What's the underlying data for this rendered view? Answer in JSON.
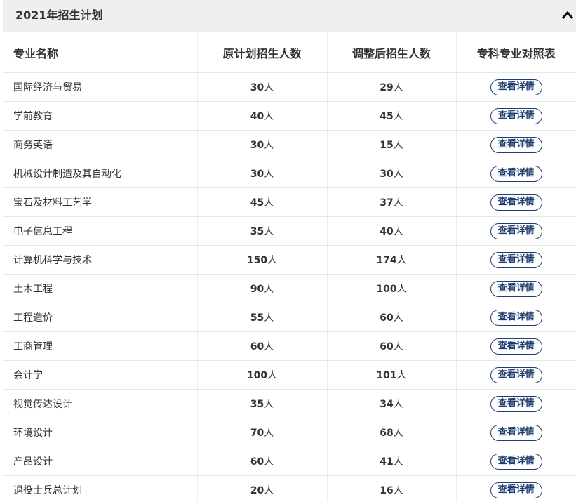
{
  "panel": {
    "title": "2021年招生计划",
    "collapse_icon": "chevron-up-icon"
  },
  "table": {
    "headers": {
      "major": "专业名称",
      "original": "原计划招生人数",
      "adjusted": "调整后招生人数",
      "comparison": "专科专业对照表"
    },
    "unit": "人",
    "button_label": "查看详情",
    "rows": [
      {
        "major": "国际经济与贸易",
        "original": "30",
        "adjusted": "29"
      },
      {
        "major": "学前教育",
        "original": "40",
        "adjusted": "45"
      },
      {
        "major": "商务英语",
        "original": "30",
        "adjusted": "15"
      },
      {
        "major": "机械设计制造及其自动化",
        "original": "30",
        "adjusted": "30"
      },
      {
        "major": "宝石及材料工艺学",
        "original": "45",
        "adjusted": "37"
      },
      {
        "major": "电子信息工程",
        "original": "35",
        "adjusted": "40"
      },
      {
        "major": "计算机科学与技术",
        "original": "150",
        "adjusted": "174"
      },
      {
        "major": "土木工程",
        "original": "90",
        "adjusted": "100"
      },
      {
        "major": "工程造价",
        "original": "55",
        "adjusted": "60"
      },
      {
        "major": "工商管理",
        "original": "60",
        "adjusted": "60"
      },
      {
        "major": "会计学",
        "original": "100",
        "adjusted": "101"
      },
      {
        "major": "视觉传达设计",
        "original": "35",
        "adjusted": "34"
      },
      {
        "major": "环境设计",
        "original": "70",
        "adjusted": "68"
      },
      {
        "major": "产品设计",
        "original": "60",
        "adjusted": "41"
      },
      {
        "major": "退役士兵总计划",
        "original": "20",
        "adjusted": "16"
      }
    ]
  },
  "colors": {
    "header_bg": "#efefef",
    "button_border": "#1f3f70",
    "text": "#333333"
  }
}
